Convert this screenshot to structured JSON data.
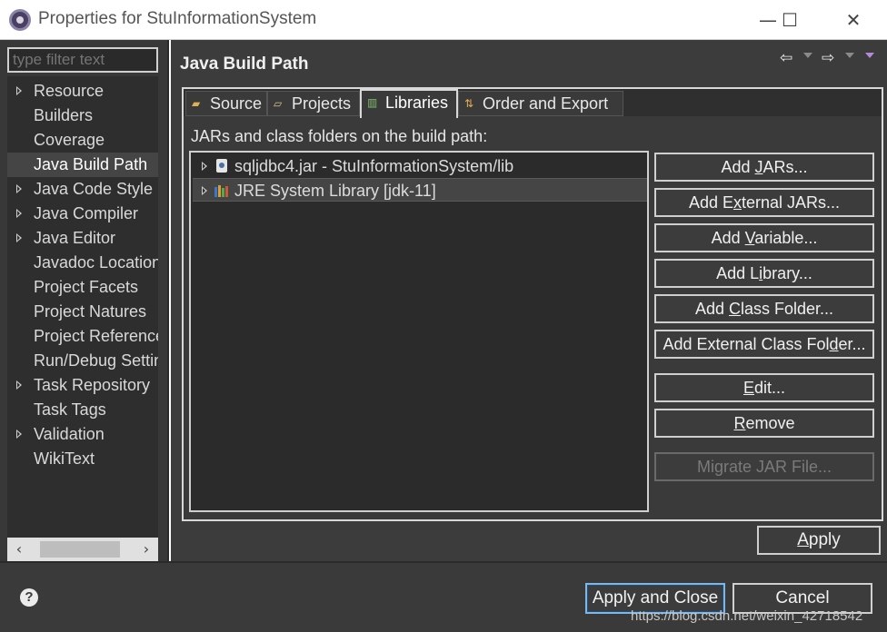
{
  "window": {
    "title": "Properties for StuInformationSystem",
    "minimize": "—",
    "maximize": "☐",
    "close": "✕"
  },
  "sidebar": {
    "filter_placeholder": "type filter text",
    "items": [
      {
        "label": "Resource",
        "expandable": true
      },
      {
        "label": "Builders",
        "expandable": false
      },
      {
        "label": "Coverage",
        "expandable": false
      },
      {
        "label": "Java Build Path",
        "expandable": false,
        "selected": true
      },
      {
        "label": "Java Code Style",
        "expandable": true
      },
      {
        "label": "Java Compiler",
        "expandable": true
      },
      {
        "label": "Java Editor",
        "expandable": true
      },
      {
        "label": "Javadoc Location",
        "expandable": false
      },
      {
        "label": "Project Facets",
        "expandable": false
      },
      {
        "label": "Project Natures",
        "expandable": false
      },
      {
        "label": "Project References",
        "expandable": false
      },
      {
        "label": "Run/Debug Settings",
        "expandable": false
      },
      {
        "label": "Task Repository",
        "expandable": true
      },
      {
        "label": "Task Tags",
        "expandable": false
      },
      {
        "label": "Validation",
        "expandable": true
      },
      {
        "label": "WikiText",
        "expandable": false
      }
    ],
    "scroll_left": "‹",
    "scroll_right": "›"
  },
  "page": {
    "title": "Java Build Path",
    "nav_back": "⇦",
    "nav_forward": "⇨",
    "tabs": [
      {
        "label": "Source",
        "icon": "source-folder-icon"
      },
      {
        "label": "Projects",
        "icon": "projects-icon"
      },
      {
        "label": "Libraries",
        "icon": "libraries-icon",
        "active": true
      },
      {
        "label": "Order and Export",
        "icon": "order-export-icon"
      }
    ],
    "description": "JARs and class folders on the build path:",
    "libraries": [
      {
        "label": "sqljdbc4.jar - StuInformationSystem/lib",
        "icon": "jar-icon"
      },
      {
        "label": "JRE System Library [jdk-11]",
        "icon": "library-icon",
        "selected": true
      }
    ],
    "buttons": {
      "add_jars": [
        "Add ",
        "J",
        "ARs..."
      ],
      "add_external_jars": [
        "Add E",
        "x",
        "ternal JARs..."
      ],
      "add_variable": [
        "Add ",
        "V",
        "ariable..."
      ],
      "add_library": [
        "Add L",
        "i",
        "brary..."
      ],
      "add_class_folder": [
        "Add ",
        "C",
        "lass Folder..."
      ],
      "add_external_class_folder": [
        "Add External Class Fol",
        "d",
        "er..."
      ],
      "edit": [
        "",
        "E",
        "dit..."
      ],
      "remove": [
        "",
        "R",
        "emove"
      ],
      "migrate": "Migrate JAR File..."
    },
    "apply": [
      "",
      "A",
      "pply"
    ]
  },
  "footer": {
    "help": "?",
    "apply_and_close": "Apply and Close",
    "cancel": "Cancel",
    "watermark": "https://blog.csdn.net/weixin_42718542"
  },
  "colors": {
    "background": "#3c3c3c",
    "tree_background": "#2e2e2e",
    "selection": "#454545",
    "default_button_border": "#7fb6e8"
  }
}
